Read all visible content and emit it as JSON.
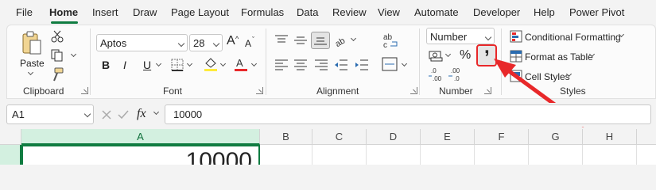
{
  "menu": {
    "items": [
      "File",
      "Home",
      "Insert",
      "Draw",
      "Page Layout",
      "Formulas",
      "Data",
      "Review",
      "View",
      "Automate",
      "Developer",
      "Help",
      "Power Pivot"
    ],
    "active": "Home"
  },
  "clipboard": {
    "paste_label": "Paste",
    "group_label": "Clipboard"
  },
  "font": {
    "name": "Aptos",
    "size": "28",
    "bold": "B",
    "italic": "I",
    "underline": "U",
    "grow": "A",
    "shrink": "A",
    "group_label": "Font"
  },
  "alignment": {
    "group_label": "Alignment"
  },
  "number": {
    "format": "Number",
    "percent": "%",
    "comma": ",",
    "group_label": "Number"
  },
  "styles": {
    "conditional": "Conditional Formatting",
    "table": "Format as Table",
    "cell_styles": "Cell Styles",
    "group_label": "Styles"
  },
  "formula_bar": {
    "name_box": "A1",
    "fx": "fx",
    "value": "10000"
  },
  "sheet": {
    "columns": [
      "A",
      "B",
      "C",
      "D",
      "E",
      "F",
      "G",
      "H"
    ],
    "selected_column": "A",
    "row": "1",
    "a1_value": "10000"
  },
  "colors": {
    "accent": "#107c41",
    "highlight": "#e8282a"
  }
}
